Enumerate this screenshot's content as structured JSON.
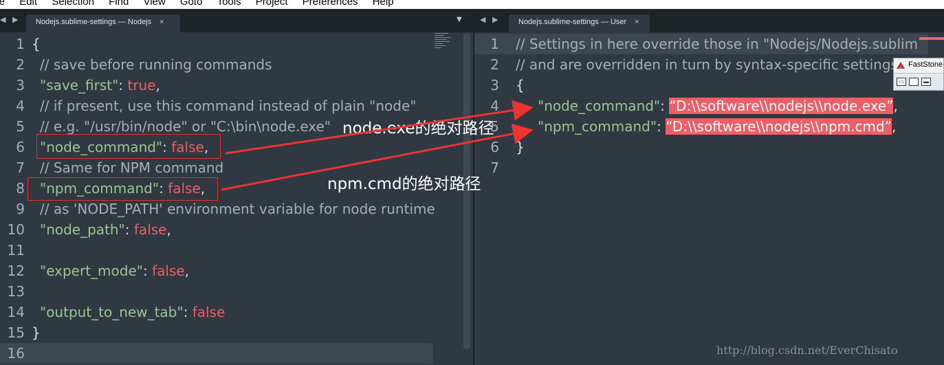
{
  "menu": {
    "items": [
      "ile",
      "Edit",
      "Selection",
      "Find",
      "View",
      "Goto",
      "Tools",
      "Project",
      "Preferences",
      "Help"
    ]
  },
  "left_pane": {
    "tab_title": "Nodejs.sublime-settings — Nodejs",
    "tab_close": "×",
    "dropdown": "▼",
    "nav_arrows": "◀ ▶",
    "line_numbers": [
      "1",
      "2",
      "3",
      "4",
      "5",
      "6",
      "7",
      "8",
      "9",
      "10",
      "11",
      "12",
      "13",
      "14",
      "15",
      "16"
    ],
    "lines": {
      "l1": "{",
      "l2": "// save before running commands",
      "l3_key": "\"save_first\"",
      "l3_colon": ": ",
      "l3_val": "true",
      "l3_end": ",",
      "l4": "// if present, use this command instead of plain \"node\"",
      "l5": "// e.g. \"/usr/bin/node\" or \"C:\\bin\\node.exe\"",
      "l6_key": "\"node_command\"",
      "l6_colon": ": ",
      "l6_val": "false",
      "l6_end": ",",
      "l7": "// Same for NPM command",
      "l8_key": "\"npm_command\"",
      "l8_colon": ": ",
      "l8_val": "false",
      "l8_end": ",",
      "l9": "// as 'NODE_PATH' environment variable for node runtime",
      "l10_key": "\"node_path\"",
      "l10_colon": ": ",
      "l10_val": "false",
      "l10_end": ",",
      "l12_key": "\"expert_mode\"",
      "l12_colon": ": ",
      "l12_val": "false",
      "l12_end": ",",
      "l14_key": "\"output_to_new_tab\"",
      "l14_colon": ": ",
      "l14_val": "false",
      "l15": "}"
    }
  },
  "right_pane": {
    "tab_title": "Nodejs.sublime-settings — User",
    "tab_close": "×",
    "nav_arrows": "◀ ▶",
    "line_numbers": [
      "1",
      "2",
      "3",
      "4",
      "5",
      "6",
      "7"
    ],
    "lines": {
      "l1": "// Settings in here override those in \"Nodejs/Nodejs.sublim",
      "l2": "// and are overridden in turn by syntax-specific settings",
      "l3": "{",
      "l4_key": "\"node_command\"",
      "l4_colon": ": ",
      "l4_val": "“D:\\\\software\\\\nodejs\\\\node.exe”",
      "l4_end": ",",
      "l5_key": "\"npm_command\"",
      "l5_colon": ": ",
      "l5_val": "“D:\\\\software\\\\nodejs\\\\npm.cmd”",
      "l5_end": ",",
      "l6": "}"
    }
  },
  "annotations": {
    "node_label": "node.exe的绝对路径",
    "npm_label": "npm.cmd的绝对路径",
    "arrow_color": "#ee3333"
  },
  "faststone": {
    "title": "FastStone",
    "buttons": [
      "open-icon",
      "window-icon",
      "minimize-icon"
    ]
  },
  "watermark": "http://blog.csdn.net/EverChisato",
  "colors": {
    "editor_bg": "#303841",
    "comment": "#a7adba",
    "key": "#99c794",
    "value": "#ec5f67",
    "text": "#d8dee9"
  }
}
